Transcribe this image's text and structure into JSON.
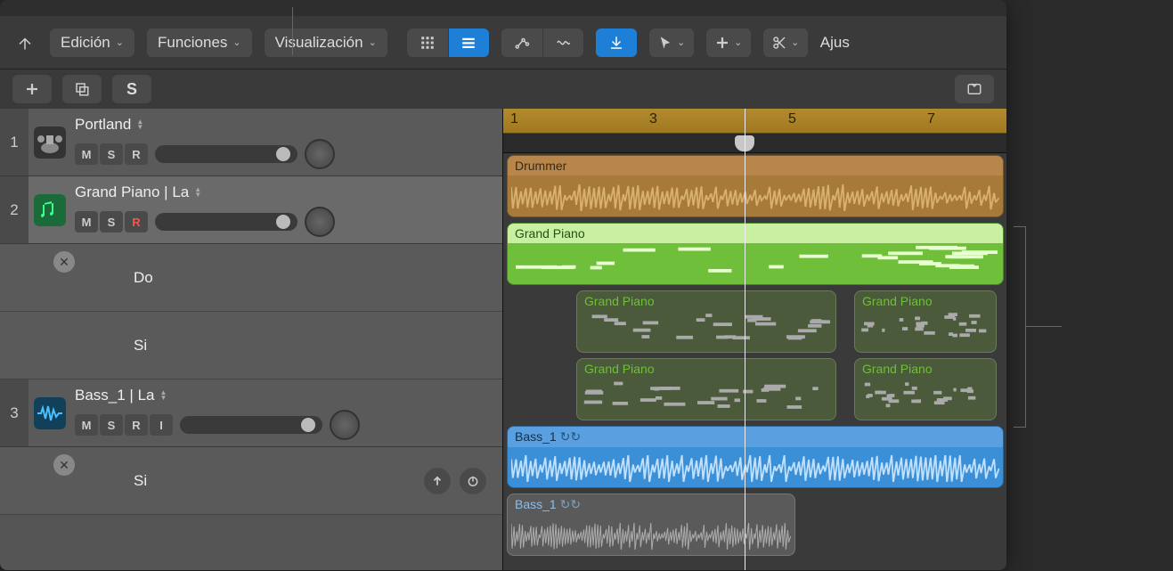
{
  "toolbar": {
    "menus": {
      "edit": "Edición",
      "functions": "Funciones",
      "view": "Visualización"
    },
    "right_label": "Ajus"
  },
  "secondbar": {
    "solo_label": "S"
  },
  "ruler": {
    "bars": [
      "1",
      "3",
      "5",
      "7"
    ]
  },
  "playhead_bar": 4.4,
  "tracks": [
    {
      "num": "1",
      "name": "Portland",
      "icon": "drumkit",
      "buttons": [
        "M",
        "S",
        "R"
      ],
      "regions": [
        {
          "kind": "drummer",
          "label": "Drummer",
          "start": 1,
          "end": 8.2,
          "row": 0
        }
      ]
    },
    {
      "num": "2",
      "name": "Grand Piano | La",
      "icon": "midi",
      "rec": true,
      "buttons": [
        "M",
        "S",
        "R"
      ],
      "subs": [
        "Do",
        "Si"
      ],
      "regions": [
        {
          "kind": "piano-main",
          "label": "Grand Piano",
          "start": 1,
          "end": 8.2,
          "row": 0
        },
        {
          "kind": "piano-sub",
          "label": "Grand Piano",
          "start": 2,
          "end": 5.8,
          "row": 1
        },
        {
          "kind": "piano-sub",
          "label": "Grand Piano",
          "start": 6,
          "end": 8.1,
          "row": 1
        },
        {
          "kind": "piano-sub",
          "label": "Grand Piano",
          "start": 2,
          "end": 5.8,
          "row": 2
        },
        {
          "kind": "piano-sub",
          "label": "Grand Piano",
          "start": 6,
          "end": 8.1,
          "row": 2
        }
      ]
    },
    {
      "num": "3",
      "name": "Bass_1 | La",
      "icon": "audio",
      "buttons": [
        "M",
        "S",
        "R",
        "I"
      ],
      "subs": [
        "Si"
      ],
      "regions": [
        {
          "kind": "bass",
          "label": "Bass_1",
          "loop": true,
          "start": 1,
          "end": 8.2,
          "row": 0
        },
        {
          "kind": "bass-sub",
          "label": "Bass_1",
          "loop": true,
          "start": 1,
          "end": 5.2,
          "row": 1
        }
      ]
    }
  ]
}
